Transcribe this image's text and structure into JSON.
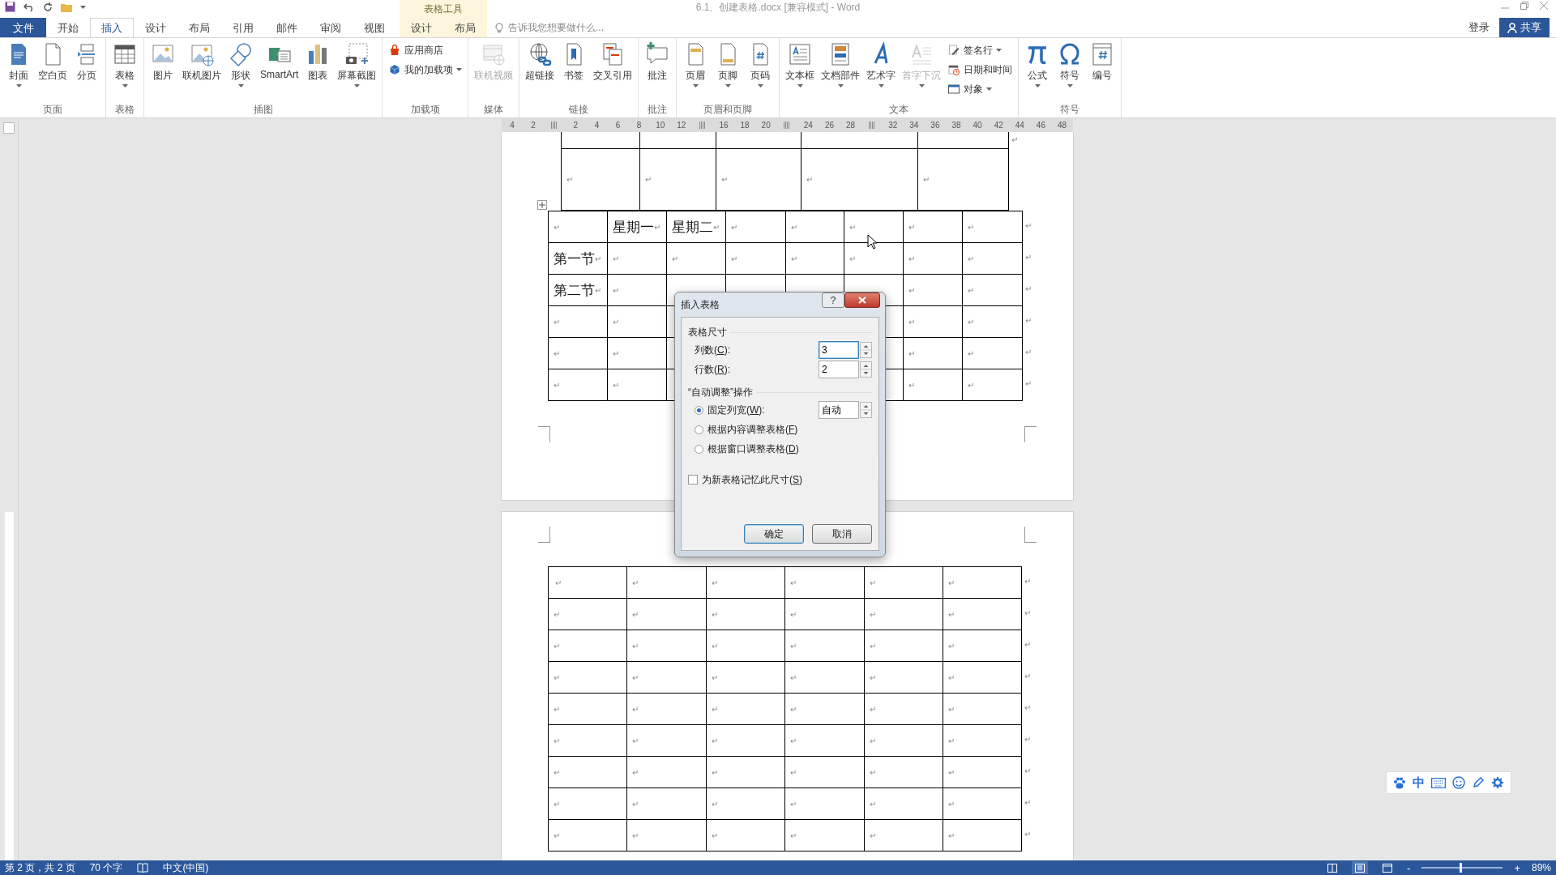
{
  "window": {
    "title": "6.1、创建表格.docx [兼容模式] - Word"
  },
  "tabs": [
    {
      "label": "文件",
      "kind": "file",
      "selected": false
    },
    {
      "label": "开始",
      "kind": "tab",
      "selected": false
    },
    {
      "label": "插入",
      "kind": "tab",
      "selected": true
    },
    {
      "label": "设计",
      "kind": "tab",
      "selected": false
    },
    {
      "label": "布局",
      "kind": "tab",
      "selected": false
    },
    {
      "label": "引用",
      "kind": "tab",
      "selected": false
    },
    {
      "label": "邮件",
      "kind": "tab",
      "selected": false
    },
    {
      "label": "审阅",
      "kind": "tab",
      "selected": false
    },
    {
      "label": "视图",
      "kind": "tab",
      "selected": false
    }
  ],
  "context_tabs": {
    "title": "表格工具",
    "tabs": [
      {
        "label": "设计",
        "selected": false
      },
      {
        "label": "布局",
        "selected": false
      }
    ]
  },
  "tell_me": {
    "placeholder": "告诉我您想要做什么..."
  },
  "account": {
    "sign_in": "登录",
    "share": "共享"
  },
  "ribbon_groups": [
    {
      "label": "页面",
      "buttons": [
        {
          "label": "封面",
          "kind": "large",
          "dropdown": true,
          "disabled": false
        },
        {
          "label": "空白页",
          "kind": "large",
          "dropdown": false,
          "disabled": false
        },
        {
          "label": "分页",
          "kind": "large",
          "dropdown": false,
          "disabled": false
        }
      ]
    },
    {
      "label": "表格",
      "buttons": [
        {
          "label": "表格",
          "kind": "large",
          "dropdown": true,
          "disabled": false
        }
      ]
    },
    {
      "label": "插图",
      "buttons": [
        {
          "label": "图片",
          "kind": "large",
          "dropdown": false,
          "disabled": false
        },
        {
          "label": "联机图片",
          "kind": "large",
          "dropdown": false,
          "disabled": false
        },
        {
          "label": "形状",
          "kind": "large",
          "dropdown": true,
          "disabled": false
        },
        {
          "label": "SmartArt",
          "kind": "large",
          "dropdown": false,
          "disabled": false
        },
        {
          "label": "图表",
          "kind": "large",
          "dropdown": false,
          "disabled": false
        },
        {
          "label": "屏幕截图",
          "kind": "large",
          "dropdown": true,
          "disabled": false
        }
      ]
    },
    {
      "label": "加载项",
      "buttons": [
        {
          "label": "应用商店",
          "kind": "small",
          "dropdown": false,
          "disabled": false
        },
        {
          "label": "我的加载项",
          "kind": "small",
          "dropdown": true,
          "disabled": false
        }
      ]
    },
    {
      "label": "媒体",
      "buttons": [
        {
          "label": "联机视频",
          "kind": "large",
          "dropdown": false,
          "disabled": true
        }
      ]
    },
    {
      "label": "链接",
      "buttons": [
        {
          "label": "超链接",
          "kind": "large",
          "dropdown": false,
          "disabled": false
        },
        {
          "label": "书签",
          "kind": "large",
          "dropdown": false,
          "disabled": false
        },
        {
          "label": "交叉引用",
          "kind": "large",
          "dropdown": false,
          "disabled": false
        }
      ]
    },
    {
      "label": "批注",
      "buttons": [
        {
          "label": "批注",
          "kind": "large",
          "dropdown": false,
          "disabled": false
        }
      ]
    },
    {
      "label": "页眉和页脚",
      "buttons": [
        {
          "label": "页眉",
          "kind": "large",
          "dropdown": true,
          "disabled": false
        },
        {
          "label": "页脚",
          "kind": "large",
          "dropdown": true,
          "disabled": false
        },
        {
          "label": "页码",
          "kind": "large",
          "dropdown": true,
          "disabled": false
        }
      ]
    },
    {
      "label": "文本",
      "buttons": [
        {
          "label": "文本框",
          "kind": "large",
          "dropdown": true,
          "disabled": false
        },
        {
          "label": "文档部件",
          "kind": "large",
          "dropdown": true,
          "disabled": false
        },
        {
          "label": "艺术字",
          "kind": "large",
          "dropdown": true,
          "disabled": false
        },
        {
          "label": "首字下沉",
          "kind": "large",
          "dropdown": true,
          "disabled": true
        },
        {
          "label": "签名行",
          "kind": "small",
          "dropdown": true,
          "disabled": false
        },
        {
          "label": "日期和时间",
          "kind": "small",
          "dropdown": false,
          "disabled": false
        },
        {
          "label": "对象",
          "kind": "small",
          "dropdown": true,
          "disabled": false
        }
      ]
    },
    {
      "label": "符号",
      "buttons": [
        {
          "label": "公式",
          "kind": "large",
          "dropdown": true,
          "disabled": false
        },
        {
          "label": "符号",
          "kind": "large",
          "dropdown": true,
          "disabled": false
        },
        {
          "label": "编号",
          "kind": "large",
          "dropdown": false,
          "disabled": false
        }
      ]
    }
  ],
  "ruler": {
    "ticks": [
      {
        "kind": "number",
        "label": "4"
      },
      {
        "kind": "number",
        "label": "2"
      },
      {
        "kind": "marker"
      },
      {
        "kind": "number",
        "label": "2"
      },
      {
        "kind": "number",
        "label": "4"
      },
      {
        "kind": "number",
        "label": "6"
      },
      {
        "kind": "number",
        "label": "8"
      },
      {
        "kind": "number",
        "label": "10"
      },
      {
        "kind": "number",
        "label": "12"
      },
      {
        "kind": "marker"
      },
      {
        "kind": "number",
        "label": "16"
      },
      {
        "kind": "number",
        "label": "18"
      },
      {
        "kind": "number",
        "label": "20"
      },
      {
        "kind": "marker"
      },
      {
        "kind": "number",
        "label": "24"
      },
      {
        "kind": "number",
        "label": "26"
      },
      {
        "kind": "number",
        "label": "28"
      },
      {
        "kind": "marker"
      },
      {
        "kind": "number",
        "label": "32"
      },
      {
        "kind": "number",
        "label": "34"
      },
      {
        "kind": "number",
        "label": "36"
      },
      {
        "kind": "number",
        "label": "38"
      },
      {
        "kind": "number",
        "label": "40"
      },
      {
        "kind": "number",
        "label": "42"
      },
      {
        "kind": "number",
        "label": "44"
      },
      {
        "kind": "number",
        "label": "46"
      },
      {
        "kind": "number",
        "label": "48"
      }
    ]
  },
  "page1": {
    "top_table": {
      "end_mark": "↵",
      "rows": [
        {
          "cells": [
            {
              "mark": "↵"
            },
            {
              "mark": "↵"
            },
            {
              "mark": "↵"
            },
            {
              "mark": "↵"
            },
            {
              "mark": "↵"
            }
          ]
        }
      ]
    },
    "table": {
      "rows": [
        {
          "end": "↵",
          "cells": [
            {
              "mark": "↵"
            },
            {
              "text": "星期一",
              "mark": "↵"
            },
            {
              "text": "星期二",
              "mark": "↵"
            },
            {
              "mark": "↵"
            },
            {
              "mark": "↵"
            },
            {
              "mark": "↵"
            },
            {
              "mark": "↵"
            },
            {
              "mark": "↵"
            }
          ]
        },
        {
          "end": "↵",
          "cells": [
            {
              "text": "第一节",
              "mark": "↵"
            },
            {
              "mark": "↵"
            },
            {
              "mark": "↵"
            },
            {
              "mark": "↵"
            },
            {
              "mark": "↵"
            },
            {
              "mark": "↵"
            },
            {
              "mark": "↵"
            },
            {
              "mark": "↵"
            }
          ]
        },
        {
          "end": "↵",
          "cells": [
            {
              "text": "第二节",
              "mark": "↵"
            },
            {
              "mark": "↵"
            },
            null,
            null,
            null,
            null,
            {
              "mark": "↵"
            },
            {
              "mark": "↵"
            }
          ]
        },
        {
          "end": "↵",
          "cells": [
            {
              "mark": "↵"
            },
            {
              "mark": "↵"
            },
            null,
            null,
            null,
            null,
            {
              "mark": "↵"
            },
            {
              "mark": "↵"
            }
          ]
        },
        {
          "end": "↵",
          "cells": [
            {
              "mark": "↵"
            },
            {
              "mark": "↵"
            },
            null,
            null,
            null,
            null,
            {
              "mark": "↵"
            },
            {
              "mark": "↵"
            }
          ]
        },
        {
          "end": "↵",
          "cells": [
            {
              "mark": "↵"
            },
            {
              "mark": "↵"
            },
            null,
            null,
            null,
            null,
            {
              "mark": "↵"
            },
            {
              "mark": "↵"
            }
          ]
        }
      ]
    }
  },
  "page2": {
    "table": {
      "rows": [
        {
          "end": "↵",
          "cells": [
            {
              "mark": "↵",
              "cursor": true
            },
            {
              "mark": "↵"
            },
            {
              "mark": "↵"
            },
            {
              "mark": "↵"
            },
            {
              "mark": "↵"
            },
            {
              "mark": "↵"
            }
          ]
        },
        {
          "end": "↵",
          "cells": [
            {
              "mark": "↵"
            },
            {
              "mark": "↵"
            },
            {
              "mark": "↵"
            },
            {
              "mark": "↵"
            },
            {
              "mark": "↵"
            },
            {
              "mark": "↵"
            }
          ]
        },
        {
          "end": "↵",
          "cells": [
            {
              "mark": "↵"
            },
            {
              "mark": "↵"
            },
            {
              "mark": "↵"
            },
            {
              "mark": "↵"
            },
            {
              "mark": "↵"
            },
            {
              "mark": "↵"
            }
          ]
        },
        {
          "end": "↵",
          "cells": [
            {
              "mark": "↵"
            },
            {
              "mark": "↵"
            },
            {
              "mark": "↵"
            },
            {
              "mark": "↵"
            },
            {
              "mark": "↵"
            },
            {
              "mark": "↵"
            }
          ]
        },
        {
          "end": "↵",
          "cells": [
            {
              "mark": "↵"
            },
            {
              "mark": "↵"
            },
            {
              "mark": "↵"
            },
            {
              "mark": "↵"
            },
            {
              "mark": "↵"
            },
            {
              "mark": "↵"
            }
          ]
        },
        {
          "end": "↵",
          "cells": [
            {
              "mark": "↵"
            },
            {
              "mark": "↵"
            },
            {
              "mark": "↵"
            },
            {
              "mark": "↵"
            },
            {
              "mark": "↵"
            },
            {
              "mark": "↵"
            }
          ]
        },
        {
          "end": "↵",
          "cells": [
            {
              "mark": "↵"
            },
            {
              "mark": "↵"
            },
            {
              "mark": "↵"
            },
            {
              "mark": "↵"
            },
            {
              "mark": "↵"
            },
            {
              "mark": "↵"
            }
          ]
        },
        {
          "end": "↵",
          "cells": [
            {
              "mark": "↵"
            },
            {
              "mark": "↵"
            },
            {
              "mark": "↵"
            },
            {
              "mark": "↵"
            },
            {
              "mark": "↵"
            },
            {
              "mark": "↵"
            }
          ]
        },
        {
          "end": "↵",
          "cells": [
            {
              "mark": "↵"
            },
            {
              "mark": "↵"
            },
            {
              "mark": "↵"
            },
            {
              "mark": "↵"
            },
            {
              "mark": "↵"
            },
            {
              "mark": "↵"
            }
          ]
        }
      ]
    }
  },
  "dialog": {
    "title": "插入表格",
    "help": "?",
    "size_group": {
      "title": "表格尺寸",
      "fields": [
        {
          "label": {
            "text": "列数(",
            "key": "C",
            "rest": "):"
          },
          "value": "3",
          "focused": true
        },
        {
          "label": {
            "text": "行数(",
            "key": "R",
            "rest": "):"
          },
          "value": "2",
          "focused": false
        }
      ]
    },
    "autofit_group": {
      "title": "“自动调整”操作",
      "options": [
        {
          "label": {
            "text": "固定列宽(",
            "key": "W",
            "rest": "):"
          },
          "selected": true,
          "value": "自动"
        },
        {
          "label": {
            "text": "根据内容调整表格(",
            "key": "F",
            "rest": ")"
          },
          "selected": false
        },
        {
          "label": {
            "text": "根据窗口调整表格(",
            "key": "D",
            "rest": ")"
          },
          "selected": false
        }
      ]
    },
    "remember": {
      "label": {
        "text": "为新表格记忆此尺寸(",
        "key": "S",
        "rest": ")"
      },
      "checked": false
    },
    "buttons": [
      {
        "label": "确定",
        "kind": "default"
      },
      {
        "label": "取消",
        "kind": "normal"
      }
    ]
  },
  "ime_toolbar": {
    "mode": "中"
  },
  "status_bar": {
    "page": "第 2 页，共 2 页",
    "words": "70 个字",
    "language": "中文(中国)",
    "views": [
      {
        "selected": false
      },
      {
        "selected": true
      },
      {
        "selected": false
      }
    ],
    "zoom_out": "-",
    "zoom_in": "+",
    "zoom_level": {
      "level": 0.47
    },
    "zoom": "89%"
  }
}
